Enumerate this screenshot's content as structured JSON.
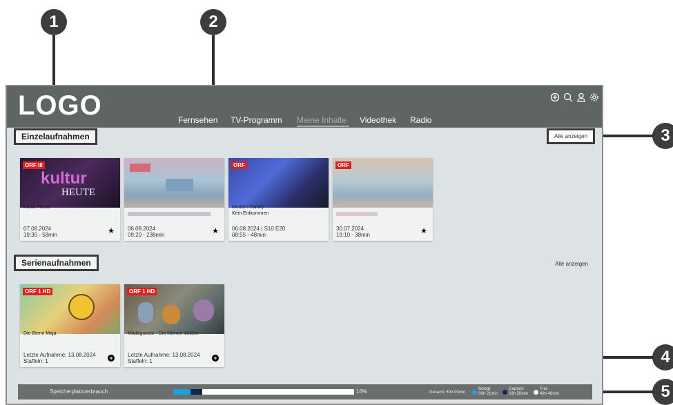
{
  "callouts": [
    "1",
    "2",
    "3",
    "4",
    "5"
  ],
  "header": {
    "logo": "LOGO",
    "nav": [
      "Fernsehen",
      "TV-Programm",
      "Meine Inhalte",
      "Videothek",
      "Radio"
    ],
    "active_nav": "Meine Inhalte",
    "icons": [
      "add-channel-icon",
      "search-icon",
      "user-icon",
      "settings-icon"
    ]
  },
  "einzel": {
    "title": "Einzelaufnahmen",
    "all_label": "Alle anzeigen",
    "cards": [
      {
        "title": "Kultur Heute",
        "subtitle": "",
        "date": "07.08.2024",
        "time": "19:35 - 58min",
        "starred": true,
        "logo_text": "kultur",
        "logo_sub": "HEUTE",
        "badge": "ORF III"
      },
      {
        "title": "",
        "subtitle": "",
        "date": "06.08.2024",
        "time": "09:20 - 238min",
        "starred": true
      },
      {
        "title": "Modern Family",
        "subtitle": "Kein Entkommen",
        "date": "06.08.2024 | S10 E20",
        "time": "08:55 - 48min",
        "starred": false,
        "badge": "ORF"
      },
      {
        "title": "",
        "subtitle": "",
        "date": "30.07.2024",
        "time": "19:10 - 38min",
        "starred": true,
        "badge": "ORF"
      }
    ]
  },
  "serien": {
    "title": "Serienaufnahmen",
    "all_label": "Alle anzeigen",
    "cards": [
      {
        "title": "Die Biene Maja",
        "date": "Letzte Aufnahme: 13.08.2024",
        "seasons": "Staffeln: 1",
        "badge": "ORF 1 HD"
      },
      {
        "title": "Madagascar - Die kleinen Wilden",
        "date": "Letzte Aufnahme: 13.08.2024",
        "seasons": "Staffeln: 1",
        "badge": "ORF 1 HD"
      }
    ]
  },
  "storage": {
    "label": "Speicherplatzverbrauch",
    "percent_text": "16%",
    "used_fraction": 0.16,
    "total": "Gesamt: 60h 00min",
    "belegt_label": "Belegt:",
    "belegt_value": "06h 21min",
    "geplant_label": "Geplant:",
    "geplant_value": "03h 50min",
    "frei_label": "Frei:",
    "frei_value": "49h 48min",
    "colors": {
      "belegt": "#1e9fde",
      "geplant": "#13254d",
      "frei": "#ffffff"
    }
  }
}
